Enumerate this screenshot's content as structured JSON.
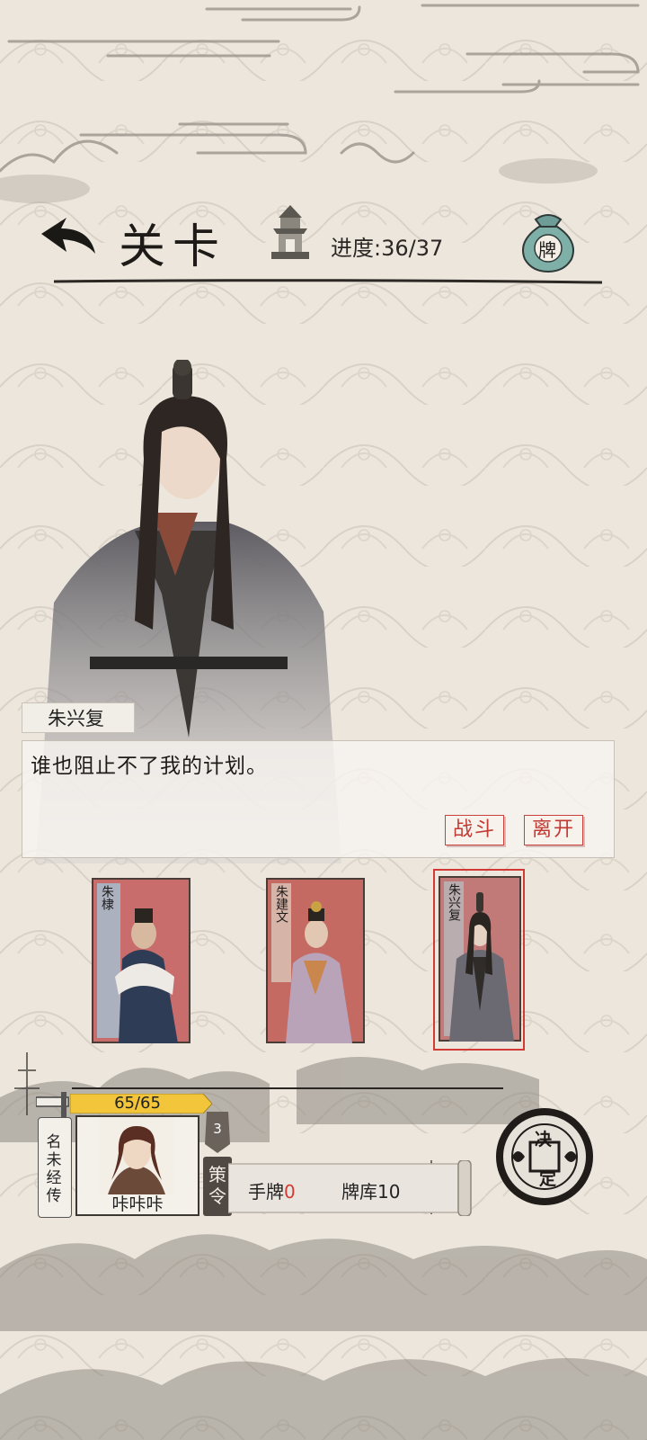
{
  "header": {
    "title": "关卡",
    "progress_label": "进度:",
    "progress_value": "36/37",
    "card_bag_label": "牌"
  },
  "dialog": {
    "speaker": "朱兴复",
    "text": "谁也阻止不了我的计划。",
    "fight_label": "战斗",
    "leave_label": "离开"
  },
  "cards": [
    {
      "name": "朱棣",
      "selected": false
    },
    {
      "name": "朱建文",
      "selected": false
    },
    {
      "name": "朱兴复",
      "selected": true
    }
  ],
  "player": {
    "hp_text": "65/65",
    "hp_fraction": 1.0,
    "title_tag": "名未经传",
    "name": "咔咔咔"
  },
  "command": {
    "count": "3",
    "label": "策令"
  },
  "resources": {
    "hand_label": "手牌",
    "hand_count": "0",
    "deck_label": "牌库",
    "deck_count": "10"
  },
  "decide_button": {
    "line1": "决",
    "line2": "定"
  },
  "colors": {
    "accent_red": "#d23b35",
    "hp_yellow": "#f2c53a",
    "paper": "#ece6dd",
    "ink": "#2a2622"
  }
}
